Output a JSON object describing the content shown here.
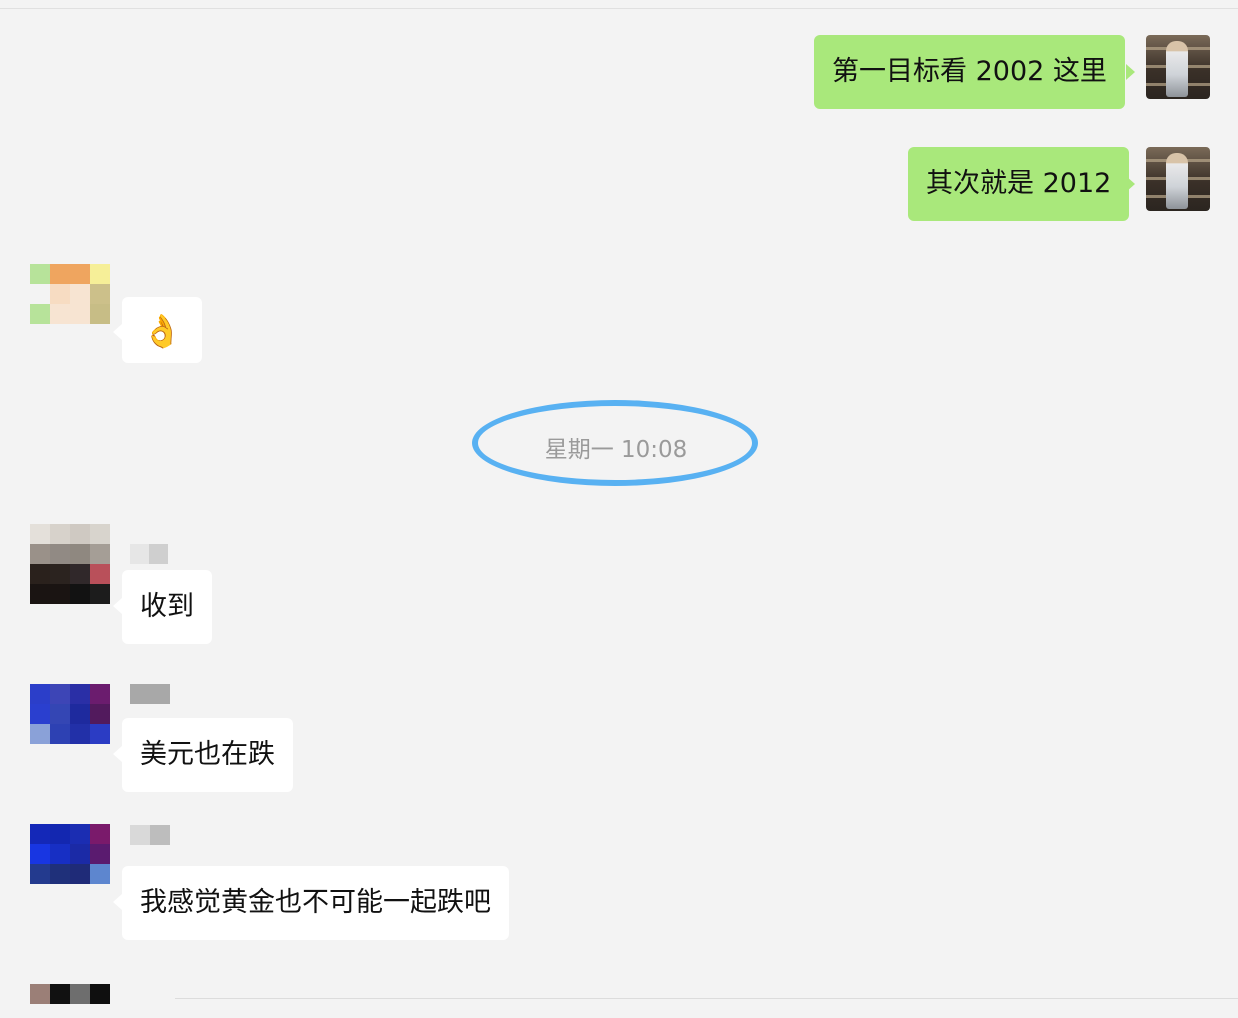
{
  "chat": {
    "timestamp": "星期一 10:08",
    "messages": [
      {
        "side": "right",
        "text": "第一目标看 2002 这里"
      },
      {
        "side": "right",
        "text": "其次就是 2012"
      },
      {
        "side": "left",
        "text": "👌"
      },
      {
        "side": "left",
        "text": "收到"
      },
      {
        "side": "left",
        "text": "美元也在跌"
      },
      {
        "side": "left",
        "text": "我感觉黄金也不可能一起跌吧"
      }
    ]
  },
  "colors": {
    "background": "#f3f3f3",
    "outgoing_bubble": "#a9e87b",
    "incoming_bubble": "#ffffff",
    "highlight_ellipse": "#58b1f2",
    "timestamp_text": "#9a9a9a"
  },
  "icons": {
    "emoji": "ok-hand-emoji",
    "avatar": "avatar-icon"
  }
}
